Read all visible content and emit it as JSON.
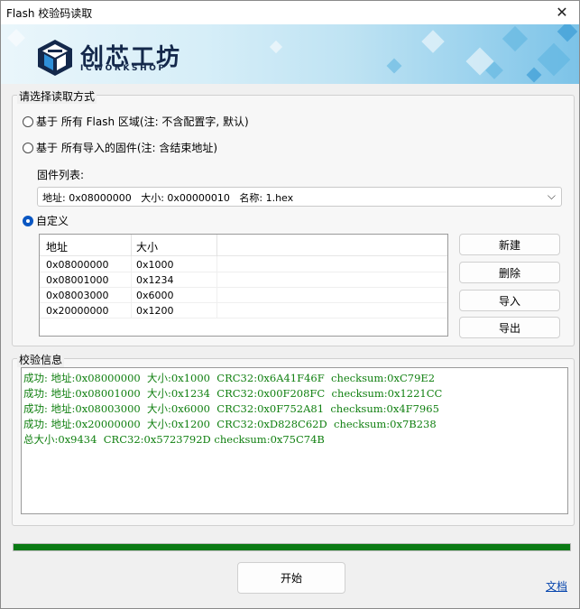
{
  "window": {
    "title": "Flash 校验码读取",
    "close_glyph": "✕"
  },
  "brand": {
    "name_cn": "创芯工坊",
    "name_en": "ICWORKSHOP"
  },
  "read_mode": {
    "group_title": "请选择读取方式",
    "options": [
      {
        "label": "基于 所有 Flash 区域(注: 不含配置字, 默认)",
        "checked": false
      },
      {
        "label": "基于 所有导入的固件(注: 含结束地址)",
        "checked": false
      },
      {
        "label": "自定义",
        "checked": true
      }
    ],
    "firmware_list_label": "固件列表:",
    "firmware_selected": "地址: 0x08000000   大小: 0x00000010   名称: 1.hex",
    "custom_table": {
      "columns": [
        "地址",
        "大小"
      ],
      "rows": [
        [
          "0x08000000",
          "0x1000"
        ],
        [
          "0x08001000",
          "0x1234"
        ],
        [
          "0x08003000",
          "0x6000"
        ],
        [
          "0x20000000",
          "0x1200"
        ]
      ]
    },
    "buttons": {
      "new": "新建",
      "delete": "删除",
      "import": "导入",
      "export": "导出"
    }
  },
  "verify_info": {
    "group_title": "校验信息",
    "lines": [
      "成功: 地址:0x08000000  大小:0x1000  CRC32:0x6A41F46F  checksum:0xC79E2",
      "成功: 地址:0x08001000  大小:0x1234  CRC32:0x00F208FC  checksum:0x1221CC",
      "成功: 地址:0x08003000  大小:0x6000  CRC32:0x0F752A81  checksum:0x4F7965",
      "成功: 地址:0x20000000  大小:0x1200  CRC32:0xD828C62D  checksum:0x7B238",
      "总大小:0x9434  CRC32:0x5723792D checksum:0x75C74B"
    ],
    "text_color": "#118011"
  },
  "progress": {
    "value": 100,
    "color": "#0a7a14"
  },
  "actions": {
    "start": "开始",
    "docs_link": "文档"
  }
}
